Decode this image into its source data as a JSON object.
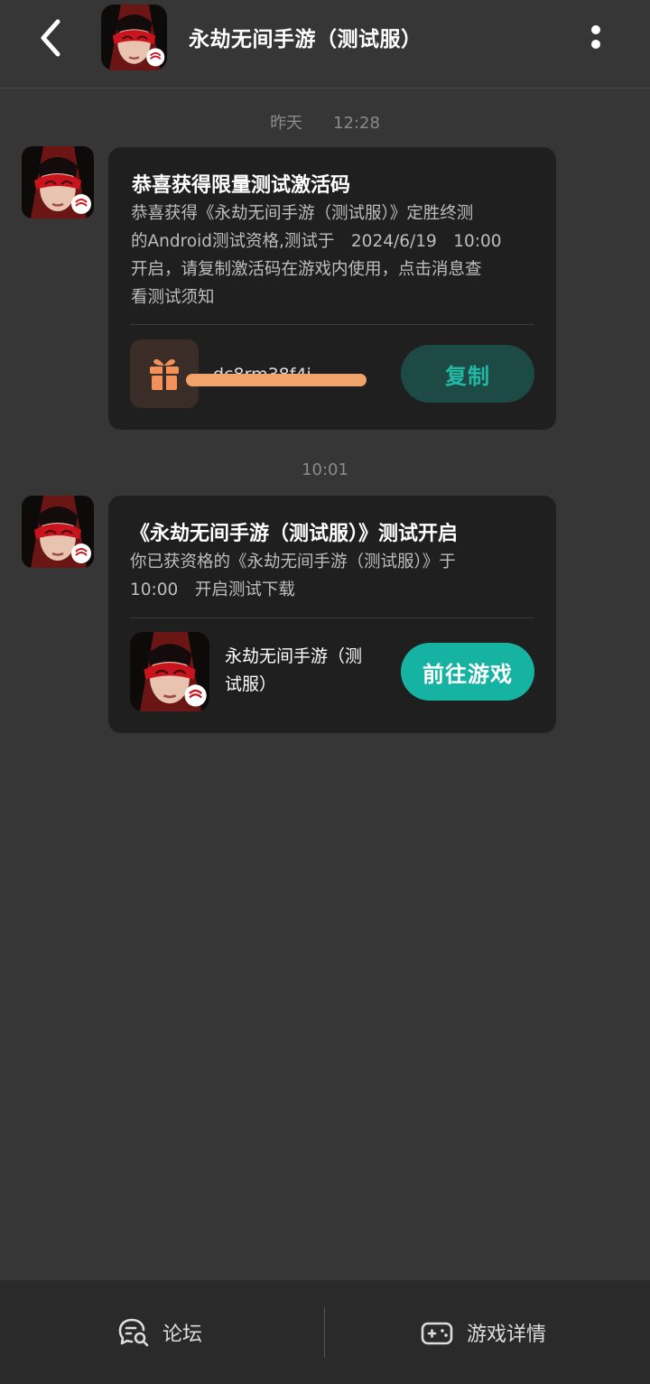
{
  "header": {
    "title": "永劫无间手游（测试服）",
    "back_icon": "chevron-left-icon",
    "more_icon": "vertical-dots-icon"
  },
  "messages": [
    {
      "timestamp_day": "昨天",
      "timestamp_time": "12:28",
      "title": "恭喜获得限量测试激活码",
      "body_lines": [
        "恭喜获得《永劫无间手游（测试服）》定胜终测",
        "的Android测试资格,测试于　2024/6/19　10:00",
        "开启，请复制激活码在游戏内使用，点击消息查",
        "看测试须知"
      ],
      "code": "dc8rm38f4j",
      "gift_icon": "gift-icon",
      "copy_label": "复制"
    },
    {
      "timestamp_time": "10:01",
      "title": "《永劫无间手游（测试服）》测试开启",
      "body_lines": [
        "你已获资格的《永劫无间手游（测试服）》于",
        "10:00　开启测试下载"
      ],
      "game_name_lines": [
        "永劫无间手游（测",
        "试服）"
      ],
      "go_label": "前往游戏"
    }
  ],
  "bottom_bar": {
    "forum_label": "论坛",
    "forum_icon": "chat-search-icon",
    "details_label": "游戏详情",
    "details_icon": "gamepad-icon"
  },
  "colors": {
    "background": "#363636",
    "card": "#1f1f1f",
    "accent": "#17b3a2",
    "redaction": "#f0a36a"
  }
}
